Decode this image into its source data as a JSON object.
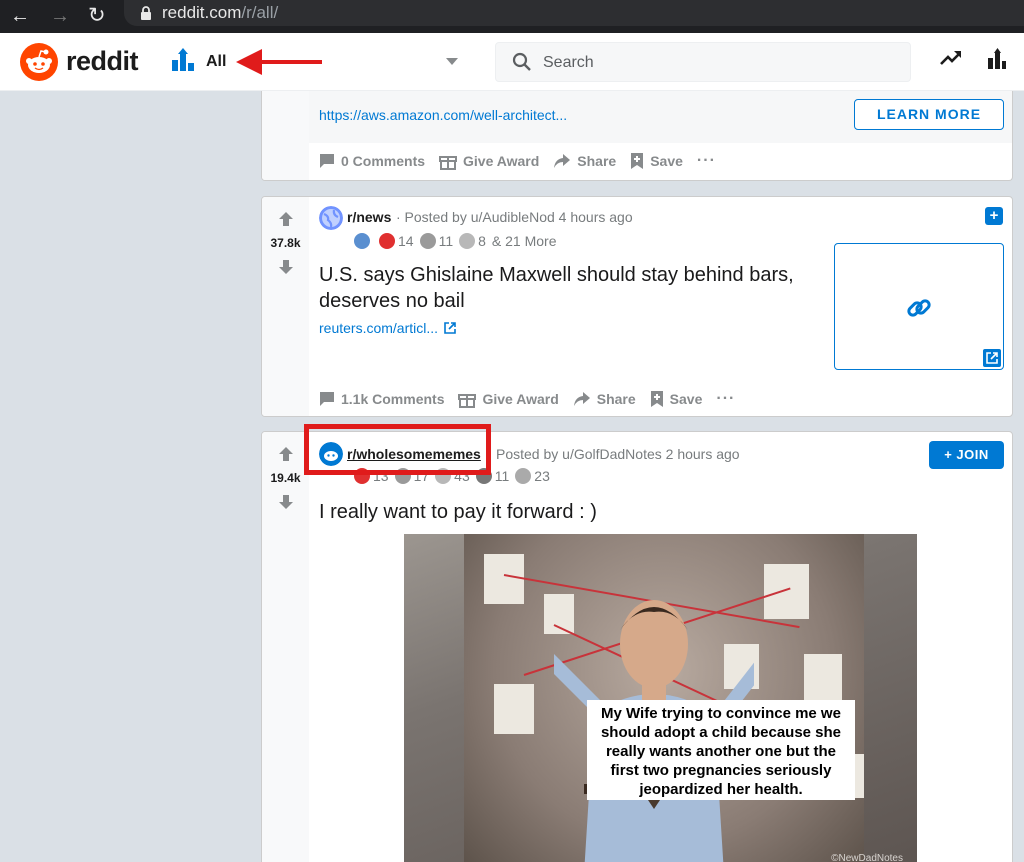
{
  "browser": {
    "url_domain": "reddit.com",
    "url_path": "/r/all/"
  },
  "header": {
    "logo_text": "reddit",
    "feed_label": "All",
    "search_placeholder": "Search"
  },
  "ad_post": {
    "link_text": "https://aws.amazon.com/well-architect...",
    "cta_label": "LEARN MORE",
    "comments_label": "0 Comments",
    "give_award_label": "Give Award",
    "share_label": "Share",
    "save_label": "Save",
    "more_label": "···"
  },
  "news_post": {
    "score": "37.8k",
    "subreddit": "r/news",
    "posted_by": "· Posted by u/AudibleNod 4 hours ago",
    "awards": [
      {
        "count": "",
        "color": "#5a8fd0"
      },
      {
        "count": "14",
        "color": "#e03030"
      },
      {
        "count": "11",
        "color": "#9a9a9a"
      },
      {
        "count": "8",
        "color": "#b8b8b8"
      }
    ],
    "awards_more": "& 21 More",
    "title": "U.S. says Ghislaine Maxwell should stay behind bars, deserves no bail",
    "domain": "reuters.com/articl...",
    "comments_label": "1.1k Comments",
    "give_award_label": "Give Award",
    "share_label": "Share",
    "save_label": "Save",
    "more_label": "···",
    "add_label": "+"
  },
  "memes_post": {
    "score": "19.4k",
    "subreddit": "r/wholesomememes",
    "posted_by": "Posted by u/GolfDadNotes 2 hours ago",
    "awards": [
      {
        "count": "13",
        "color": "#e03030"
      },
      {
        "count": "17",
        "color": "#9a9a9a"
      },
      {
        "count": "43",
        "color": "#b8b8b8"
      },
      {
        "count": "11",
        "color": "#777"
      },
      {
        "count": "23",
        "color": "#aaa"
      }
    ],
    "join_label": "+ JOIN",
    "title": "I really want to pay it forward : )",
    "meme_caption": "My Wife trying to convince me we should adopt a child because she really wants another one but the first two pregnancies seriously jeopardized her health.",
    "watermark": "©NewDadNotes"
  },
  "colors": {
    "brand": "#ff4500",
    "link_blue": "#0079d3",
    "annotation_red": "#e01b1b"
  }
}
